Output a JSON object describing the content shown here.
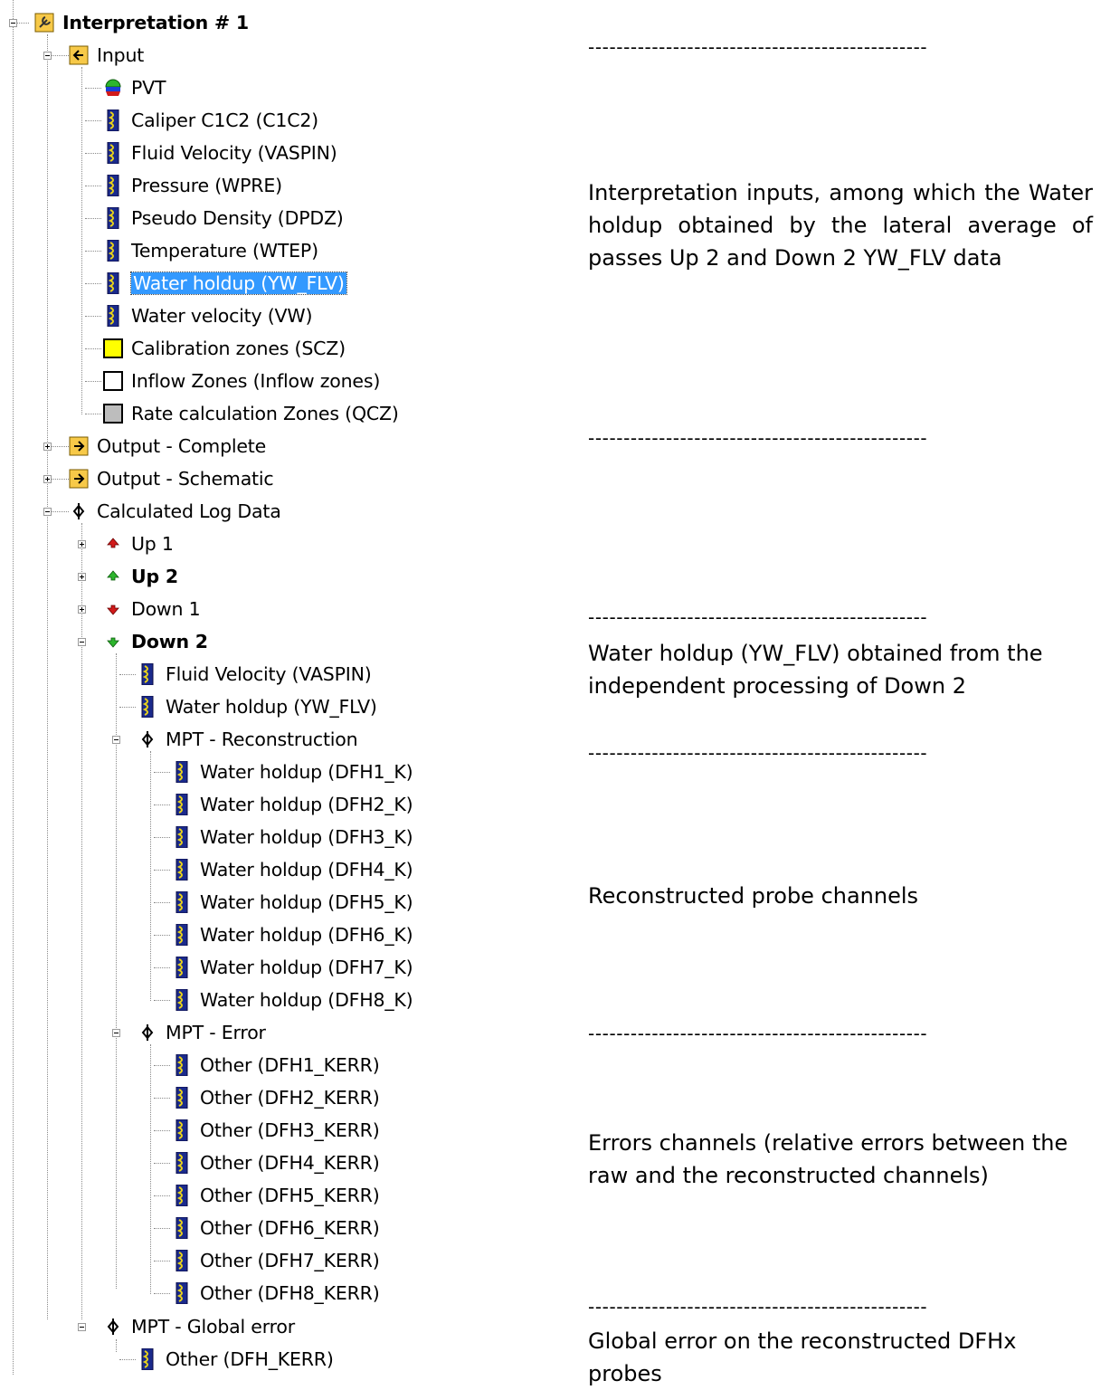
{
  "tree": {
    "root": "Interpretation # 1",
    "input": {
      "label": "Input",
      "items": [
        "PVT",
        "Caliper C1C2 (C1C2)",
        "Fluid Velocity (VASPIN)",
        "Pressure (WPRE)",
        "Pseudo Density (DPDZ)",
        "Temperature (WTEP)",
        "Water holdup (YW_FLV)",
        "Water velocity (VW)",
        "Calibration zones (SCZ)",
        "Inflow Zones (Inflow zones)",
        "Rate calculation Zones (QCZ)"
      ],
      "selected": "Water holdup (YW_FLV)"
    },
    "output_complete": "Output - Complete",
    "output_schematic": "Output - Schematic",
    "calculated_log_data": {
      "label": "Calculated Log Data",
      "passes": [
        "Up 1",
        "Up 2",
        "Down 1",
        "Down 2"
      ],
      "down2": {
        "items": [
          "Fluid Velocity (VASPIN)",
          "Water holdup (YW_FLV)"
        ],
        "reconstruction": {
          "label": "MPT - Reconstruction",
          "items": [
            "Water holdup (DFH1_K)",
            "Water holdup (DFH2_K)",
            "Water holdup (DFH3_K)",
            "Water holdup (DFH4_K)",
            "Water holdup (DFH5_K)",
            "Water holdup (DFH6_K)",
            "Water holdup (DFH7_K)",
            "Water holdup (DFH8_K)"
          ]
        },
        "error": {
          "label": "MPT - Error",
          "items": [
            "Other (DFH1_KERR)",
            "Other (DFH2_KERR)",
            "Other (DFH3_KERR)",
            "Other (DFH4_KERR)",
            "Other (DFH5_KERR)",
            "Other (DFH6_KERR)",
            "Other (DFH7_KERR)",
            "Other (DFH8_KERR)"
          ]
        }
      },
      "global_error": {
        "label": "MPT - Global error",
        "items": [
          "Other (DFH_KERR)"
        ]
      }
    }
  },
  "notes": {
    "separator": "------------------------------------------------",
    "inputs": "Interpretation inputs, among which the Water holdup obtained by the lateral average of passes Up 2 and Down 2 YW_FLV data",
    "down2": "Water holdup (YW_FLV) obtained from the independent processing of Down 2",
    "reconstructed": "Reconstructed probe channels",
    "errors": "Errors channels (relative errors between the raw and the reconstructed channels)",
    "global": "Global error on the reconstructed DFHx probes"
  },
  "colors": {
    "selection": "#3399ff",
    "folder_fill": "#f7c948",
    "log_icon_blue": "#1a2a8c",
    "log_icon_yellow": "#e8d21c",
    "up_arrow_up1": "#d11a1a",
    "up_arrow_up2": "#2db52d",
    "down_arrow_down1": "#d11a1a",
    "down_arrow_down2": "#2db52d",
    "calibration_zone": "#ffff00",
    "rate_zone": "#bdbdbd"
  }
}
